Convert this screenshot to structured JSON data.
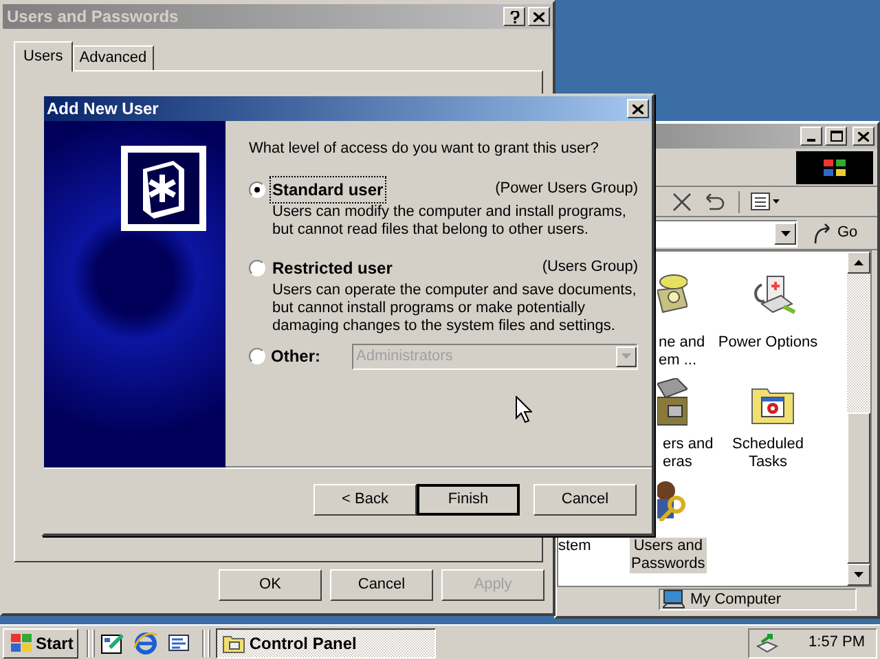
{
  "users_window": {
    "title": "Users and Passwords",
    "tabs": [
      {
        "label": "Users",
        "selected": true
      },
      {
        "label": "Advanced",
        "selected": false
      }
    ],
    "buttons": [
      {
        "label": "OK",
        "disabled": false
      },
      {
        "label": "Cancel",
        "disabled": false
      },
      {
        "label": "Apply",
        "disabled": true
      }
    ]
  },
  "explorer_window": {
    "go": "Go",
    "items": [
      {
        "kind": "phone",
        "lines": [
          "ne and",
          "em ..."
        ],
        "selected": false
      },
      {
        "kind": "power",
        "lines": [
          "Power Options"
        ],
        "selected": false
      },
      {
        "kind": "scanner",
        "lines": [
          "ers and",
          "eras"
        ],
        "selected": false
      },
      {
        "kind": "tasks",
        "lines": [
          "Scheduled",
          "Tasks"
        ],
        "selected": false
      },
      {
        "kind": "system",
        "lines": [
          "stem"
        ],
        "selected": false
      },
      {
        "kind": "users",
        "lines": [
          "Users and",
          "Passwords"
        ],
        "selected": true
      }
    ],
    "status": "My Computer"
  },
  "dialog": {
    "title": "Add New User",
    "question": "What level of access do you want to grant this user?",
    "options": [
      {
        "kind": "radio",
        "label": "Standard user",
        "group": "(Power Users Group)",
        "description": "Users can modify the computer and install programs, but cannot read files that belong to other users.",
        "selected": true
      },
      {
        "kind": "radio",
        "label": "Restricted user",
        "group": "(Users Group)",
        "description": "Users can operate the computer and save documents, but cannot install programs or make potentially damaging changes to the system files and settings.",
        "selected": false
      },
      {
        "kind": "select",
        "label": "Other:",
        "value": "Administrators",
        "disabled": true,
        "selected": false
      }
    ],
    "buttons": [
      {
        "label": "< Back",
        "default": false
      },
      {
        "label": "Finish",
        "default": true
      },
      {
        "label": "Cancel",
        "default": false
      }
    ]
  },
  "taskbar": {
    "start": "Start",
    "tasks": [
      {
        "label": "Control Panel",
        "selected": true
      }
    ],
    "clock": "1:57 PM"
  }
}
